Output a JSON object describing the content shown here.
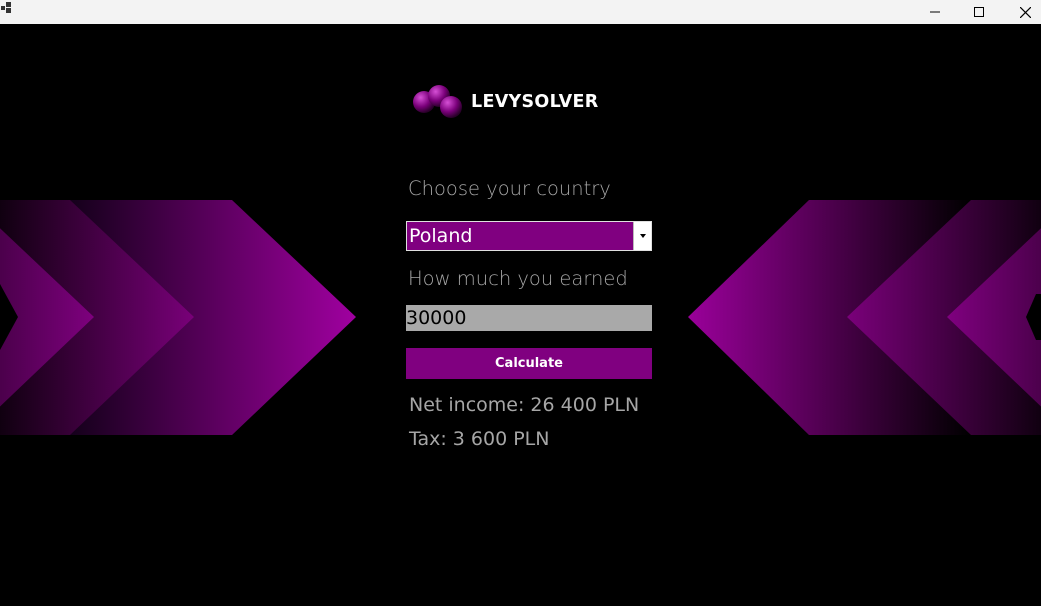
{
  "window": {
    "minimize_icon": "minimize-icon",
    "maximize_icon": "maximize-icon",
    "close_icon": "close-icon"
  },
  "logo": {
    "text": "LEVYSOLVER"
  },
  "form": {
    "country_label": "Choose your country",
    "country_value": "Poland",
    "earned_label": "How much you earned",
    "earned_value": "30000",
    "calculate_label": "Calculate"
  },
  "results": {
    "net_income": "Net income: 26 400 PLN",
    "tax": "Tax: 3 600 PLN"
  },
  "colors": {
    "accent": "#800080",
    "background": "#000000",
    "label_text": "#a6a6a6",
    "input_bg": "#a9a9a9"
  }
}
